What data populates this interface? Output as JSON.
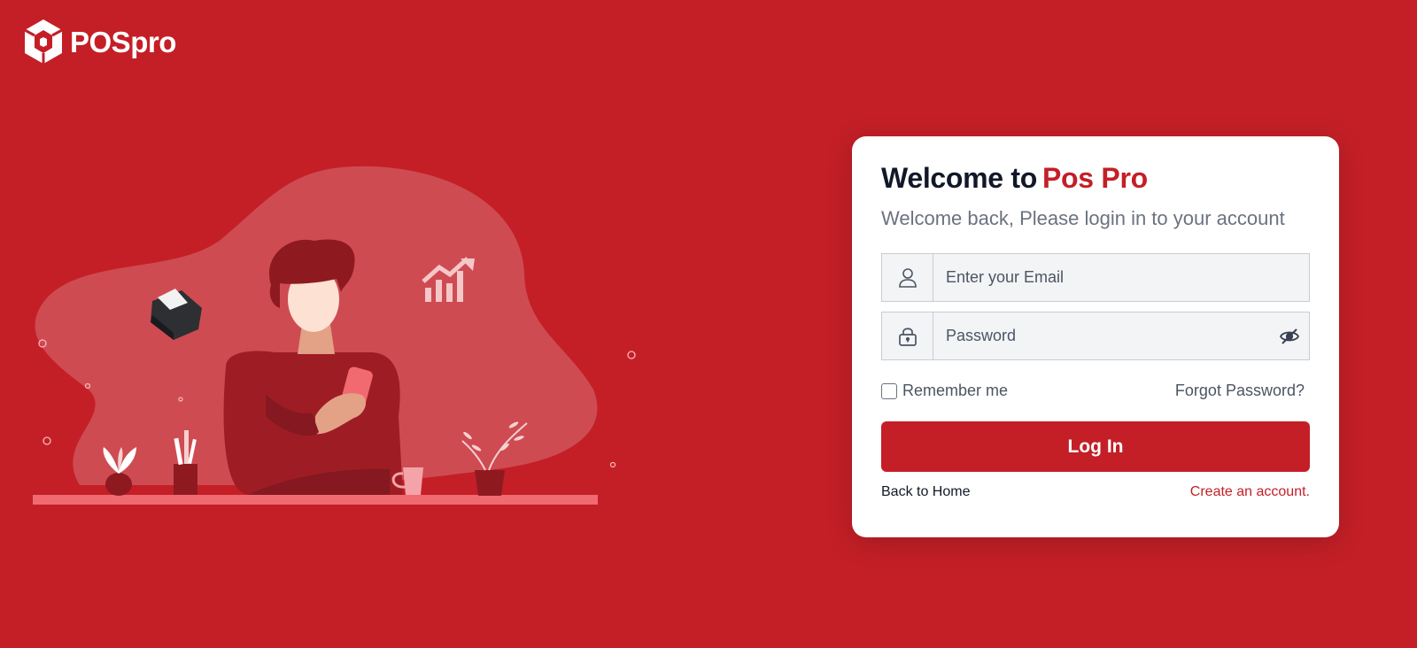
{
  "brand": {
    "name": "POSpro",
    "icon": "pospro-logo-icon"
  },
  "card": {
    "title_prefix": "Welcome to",
    "title_brand": "Pos Pro",
    "subtitle": "Welcome back, Please login in to your account"
  },
  "email": {
    "placeholder": "Enter your Email",
    "value": "",
    "icon": "user-icon"
  },
  "password": {
    "placeholder": "Password",
    "value": "",
    "icon": "lock-icon",
    "toggle_icon": "eye-off-icon"
  },
  "remember": {
    "label": "Remember me",
    "checked": false
  },
  "forgot_label": "Forgot Password?",
  "login_label": "Log In",
  "back_home_label": "Back to Home",
  "create_account_label": "Create an account.",
  "colors": {
    "primary": "#c41f27",
    "card_bg": "#ffffff",
    "input_bg": "#f3f4f6"
  }
}
